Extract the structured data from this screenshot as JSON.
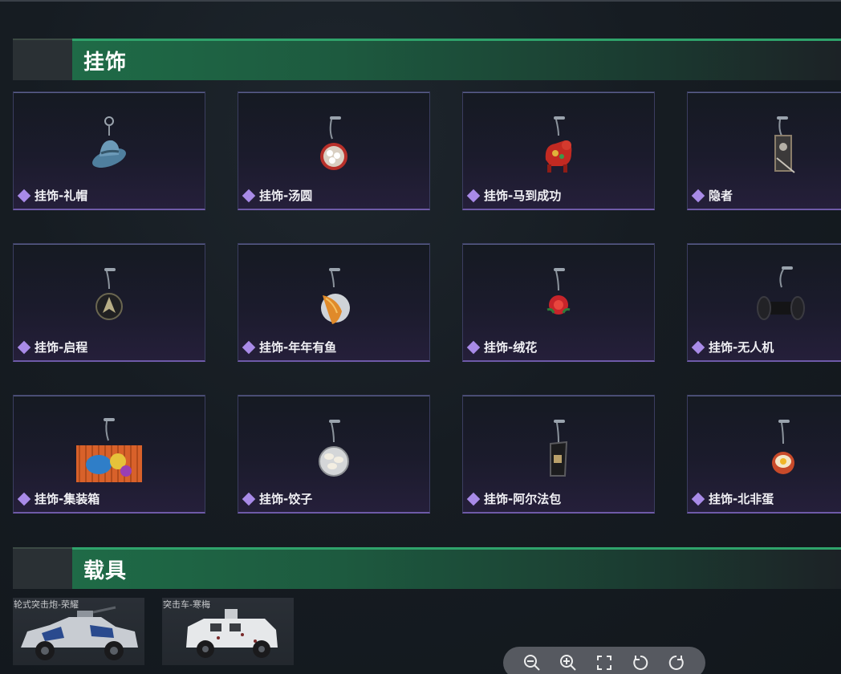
{
  "sections": {
    "charms": {
      "title": "挂饰",
      "items": [
        {
          "label": "挂饰-礼帽",
          "icon": "hat-charm-icon"
        },
        {
          "label": "挂饰-汤圆",
          "icon": "tangyuan-charm-icon"
        },
        {
          "label": "挂饰-马到成功",
          "icon": "horse-charm-icon"
        },
        {
          "label": "隐者",
          "icon": "hermit-charm-icon"
        },
        {
          "label": "挂饰-启程",
          "icon": "compass-charm-icon"
        },
        {
          "label": "挂饰-年年有鱼",
          "icon": "fish-charm-icon"
        },
        {
          "label": "挂饰-绒花",
          "icon": "flower-charm-icon"
        },
        {
          "label": "挂饰-无人机",
          "icon": "drone-charm-icon"
        },
        {
          "label": "挂饰-集装箱",
          "icon": "container-charm-icon"
        },
        {
          "label": "挂饰-饺子",
          "icon": "dumpling-charm-icon"
        },
        {
          "label": "挂饰-阿尔法包",
          "icon": "alpha-bag-charm-icon"
        },
        {
          "label": "挂饰-北非蛋",
          "icon": "shakshuka-charm-icon"
        }
      ]
    },
    "vehicles": {
      "title": "载具",
      "items": [
        {
          "label": "轮式突击炮-荣耀"
        },
        {
          "label": "突击车-寒梅"
        }
      ]
    }
  },
  "toolbar": {
    "buttons": [
      "zoom-out-icon",
      "zoom-in-icon",
      "fullscreen-icon",
      "rotate-left-icon",
      "rotate-right-icon"
    ]
  },
  "colors": {
    "accent_green": "#2fa36b",
    "rarity_purple": "#a98be8",
    "card_border": "#6e5aa8"
  }
}
